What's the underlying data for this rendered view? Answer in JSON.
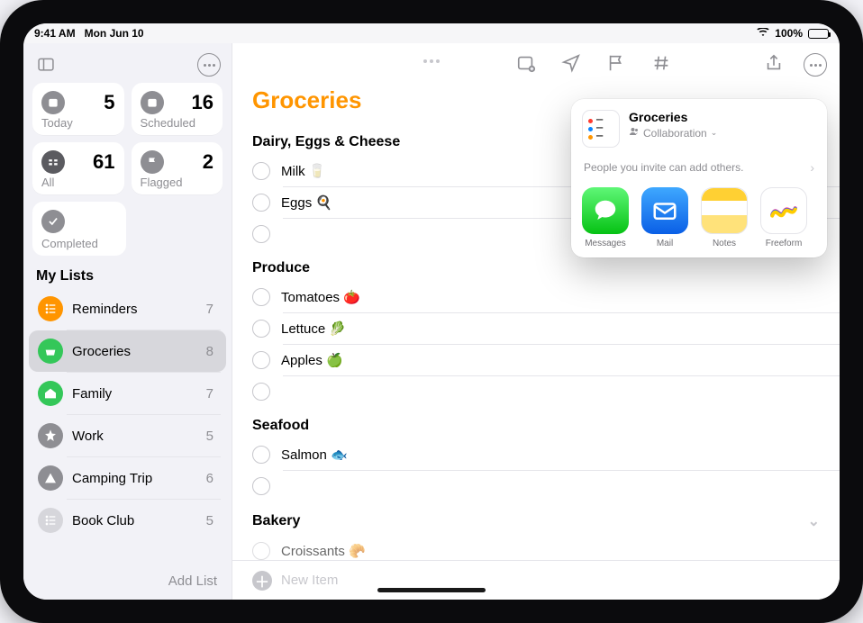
{
  "status": {
    "time": "9:41 AM",
    "date": "Mon Jun 10",
    "battery_pct": "100%"
  },
  "sidebar": {
    "smart": {
      "today": {
        "label": "Today",
        "count": "5"
      },
      "scheduled": {
        "label": "Scheduled",
        "count": "16"
      },
      "all": {
        "label": "All",
        "count": "61"
      },
      "flagged": {
        "label": "Flagged",
        "count": "2"
      },
      "completed": {
        "label": "Completed"
      }
    },
    "mylists_header": "My Lists",
    "lists": [
      {
        "name": "Reminders",
        "count": "7",
        "color": "orange"
      },
      {
        "name": "Groceries",
        "count": "8",
        "color": "green",
        "selected": true
      },
      {
        "name": "Family",
        "count": "7",
        "color": "green"
      },
      {
        "name": "Work",
        "count": "5",
        "color": "gray"
      },
      {
        "name": "Camping Trip",
        "count": "6",
        "color": "gray"
      },
      {
        "name": "Book Club",
        "count": "5",
        "color": "pink"
      }
    ],
    "add_list_label": "Add List"
  },
  "main": {
    "title": "Groceries",
    "sections": [
      {
        "name": "Dairy, Eggs & Cheese",
        "items": [
          "Milk 🥛",
          "Eggs 🍳"
        ]
      },
      {
        "name": "Produce",
        "items": [
          "Tomatoes 🍅",
          "Lettuce 🥬",
          "Apples 🍏"
        ]
      },
      {
        "name": "Seafood",
        "items": [
          "Salmon 🐟"
        ]
      },
      {
        "name": "Bakery",
        "items": [
          "Croissants 🥐"
        ],
        "collapsed_indicator": true
      }
    ],
    "new_item_label": "New Item"
  },
  "share": {
    "title": "Groceries",
    "subtitle": "Collaboration",
    "note": "People you invite can add others.",
    "apps": [
      {
        "label": "Messages"
      },
      {
        "label": "Mail"
      },
      {
        "label": "Notes"
      },
      {
        "label": "Freeform"
      }
    ]
  }
}
